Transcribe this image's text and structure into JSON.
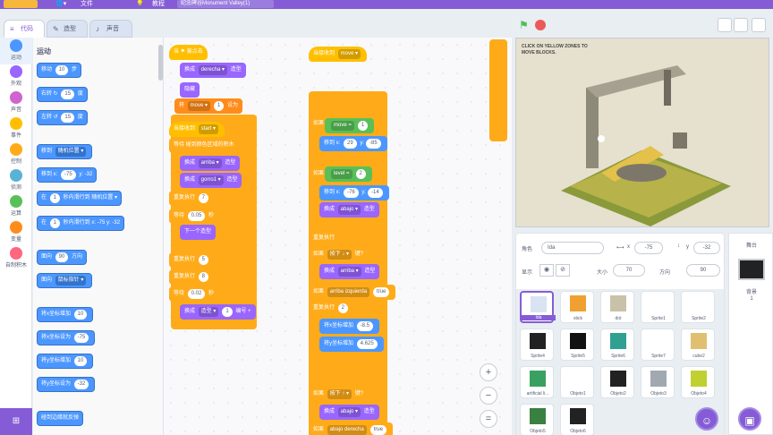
{
  "menu": {
    "file_label": "文件",
    "tutorial_label": "教程",
    "project_title": "纪念碑谷Monument Valley(1)"
  },
  "tabs": [
    {
      "label": "代码",
      "icon": "code-icon"
    },
    {
      "label": "造型",
      "icon": "brush-icon"
    },
    {
      "label": "声音",
      "icon": "speaker-icon"
    }
  ],
  "categories": [
    {
      "label": "运动",
      "color": "#4c97ff"
    },
    {
      "label": "外观",
      "color": "#9966ff"
    },
    {
      "label": "声音",
      "color": "#cf63cf"
    },
    {
      "label": "事件",
      "color": "#ffbf00"
    },
    {
      "label": "控制",
      "color": "#ffab19"
    },
    {
      "label": "侦测",
      "color": "#5cb1d6"
    },
    {
      "label": "运算",
      "color": "#59c059"
    },
    {
      "label": "变量",
      "color": "#ff8c1a"
    },
    {
      "label": "自制积木",
      "color": "#ff6680"
    }
  ],
  "palette": {
    "section_title": "运动",
    "blocks": [
      {
        "pre": "移动",
        "val": "10",
        "post": "步"
      },
      {
        "pre": "右转 ↻",
        "val": "15",
        "post": "度"
      },
      {
        "pre": "左转 ↺",
        "val": "15",
        "post": "度"
      },
      {
        "pre": "移到",
        "dd": "随机位置 ▾",
        "post": ""
      },
      {
        "pre": "移到 x:",
        "val": "-75",
        "post": "y: -32"
      },
      {
        "pre": "在",
        "val": "1",
        "post": "秒内滑行到 随机位置 ▾"
      },
      {
        "pre": "在",
        "val": "1",
        "post": "秒内滑行到 x: -75 y: -32"
      },
      {
        "pre": "面向",
        "val": "90",
        "post": "方向"
      },
      {
        "pre": "面向",
        "dd": "鼠标指针 ▾",
        "post": ""
      },
      {
        "pre": "将x坐标增加",
        "val": "10",
        "post": ""
      },
      {
        "pre": "将x坐标设为",
        "val": "-75",
        "post": ""
      },
      {
        "pre": "将y坐标增加",
        "val": "10",
        "post": ""
      },
      {
        "pre": "将y坐标设为",
        "val": "-32",
        "post": ""
      },
      {
        "pre": "碰到边缘就反弹",
        "val": "",
        "post": ""
      }
    ]
  },
  "scripts": {
    "col1": [
      {
        "kind": "ev hat",
        "text": "当 ⚑ 被点击"
      },
      {
        "kind": "look",
        "text": "换成",
        "dd": "derecha ▾",
        "post": "造型"
      },
      {
        "kind": "look",
        "text": "隐藏"
      },
      {
        "kind": "var",
        "text": "将",
        "dd": "move ▾",
        "post": "设为",
        "val": "1"
      },
      {
        "kind": "ev hat",
        "text": "当接收到",
        "dd": "start ▾"
      },
      {
        "kind": "ctl",
        "text": "等待",
        "post": "碰到颜色区域的积木"
      },
      {
        "kind": "look",
        "text": "换成",
        "dd": "arriba ▾",
        "post": "造型"
      },
      {
        "kind": "look",
        "text": "换成",
        "dd": "gorro1 ▾",
        "post": "造型"
      },
      {
        "kind": "ctl",
        "text": "重复执行",
        "val": "7"
      },
      {
        "kind": "ctl",
        "text": "等待",
        "val": "0.05",
        "post": "秒"
      },
      {
        "kind": "look",
        "text": "下一个造型"
      },
      {
        "kind": "ctl",
        "text": "重复执行",
        "val": "5"
      },
      {
        "kind": "ctl",
        "text": "重复执行",
        "val": "8"
      },
      {
        "kind": "ctl",
        "text": "等待",
        "val": "0.02",
        "post": "秒"
      },
      {
        "kind": "look",
        "text": "换成",
        "dd": "造型 ▾",
        "post": "编号 +",
        "val": "1"
      }
    ],
    "col2": [
      {
        "kind": "ev hat",
        "text": "当接收到",
        "dd": "move ▾"
      },
      {
        "kind": "ctl",
        "text": "如果"
      },
      {
        "kind": "op",
        "text": "",
        "dd": "move =",
        "val": "1"
      },
      {
        "kind": "mot",
        "text": "移到 x:",
        "val": "29",
        "post": "y:",
        "val2": "-85"
      },
      {
        "kind": "ctl",
        "text": "如果"
      },
      {
        "kind": "op",
        "text": "",
        "dd": "level =",
        "val": "2"
      },
      {
        "kind": "mot",
        "text": "移到 x:",
        "val": "-76",
        "post": "y:",
        "val2": "-14"
      },
      {
        "kind": "look",
        "text": "换成",
        "dd": "abajo ▾",
        "post": "造型"
      },
      {
        "kind": "ctl",
        "text": "重复执行"
      },
      {
        "kind": "ctl",
        "text": "如果",
        "dd": "按下 ↓ ▾",
        "post": "键?"
      },
      {
        "kind": "look",
        "text": "换成",
        "dd": "arriba ▾",
        "post": "造型"
      },
      {
        "kind": "ctl",
        "text": "如果",
        "dd": "arriba izquierda",
        "val": "true"
      },
      {
        "kind": "ctl",
        "text": "重复执行",
        "val": "2"
      },
      {
        "kind": "mot",
        "text": "将x坐标增加",
        "val": "-8.5"
      },
      {
        "kind": "mot",
        "text": "将y坐标增加",
        "val": "4.625"
      },
      {
        "kind": "ctl",
        "text": "如果",
        "dd": "按下 ↑ ▾",
        "post": "键?"
      },
      {
        "kind": "look",
        "text": "换成",
        "dd": "abajo ▾",
        "post": "造型"
      },
      {
        "kind": "ctl",
        "text": "如果",
        "dd": "abajo derecha",
        "val": "true"
      }
    ]
  },
  "stage": {
    "hint": "CLICK ON YELLOW ZONES TO MOVE BLOCKS."
  },
  "sprite_info": {
    "sprite_label": "角色",
    "sprite_name": "Ida",
    "x_label": "x",
    "x_value": "-75",
    "y_label": "y",
    "y_value": "-32",
    "show_label": "显示",
    "size_label": "大小",
    "size_value": "70",
    "direction_label": "方向",
    "direction_value": "90"
  },
  "sprites": [
    {
      "name": "Ida",
      "thumb": "#d9e3f2",
      "sel": true
    },
    {
      "name": "stick",
      "thumb": "#f0a030"
    },
    {
      "name": "dot",
      "thumb": "#c9c2a8"
    },
    {
      "name": "Sprite1",
      "thumb": "#ffffff"
    },
    {
      "name": "Sprite2",
      "thumb": "#ffffff"
    },
    {
      "name": "Sprite4",
      "thumb": "#222222"
    },
    {
      "name": "Sprite5",
      "thumb": "#111111"
    },
    {
      "name": "Sprite6",
      "thumb": "#30a090"
    },
    {
      "name": "Sprite7",
      "thumb": "#ffffff"
    },
    {
      "name": "cube2",
      "thumb": "#e0c070"
    },
    {
      "name": "artificial li...",
      "thumb": "#3aa060"
    },
    {
      "name": "Objeto1",
      "thumb": "#ffffff"
    },
    {
      "name": "Objeto2",
      "thumb": "#222222"
    },
    {
      "name": "Objeto3",
      "thumb": "#a0a8b0"
    },
    {
      "name": "Objeto4",
      "thumb": "#c0d030"
    },
    {
      "name": "Objeto5",
      "thumb": "#3a8040"
    },
    {
      "name": "Objeto6",
      "thumb": "#222222"
    }
  ],
  "stage_target": {
    "title": "舞台",
    "backdrops_label": "背景",
    "backdrops_count": "1"
  },
  "zoom": [
    "+",
    "−",
    "="
  ]
}
